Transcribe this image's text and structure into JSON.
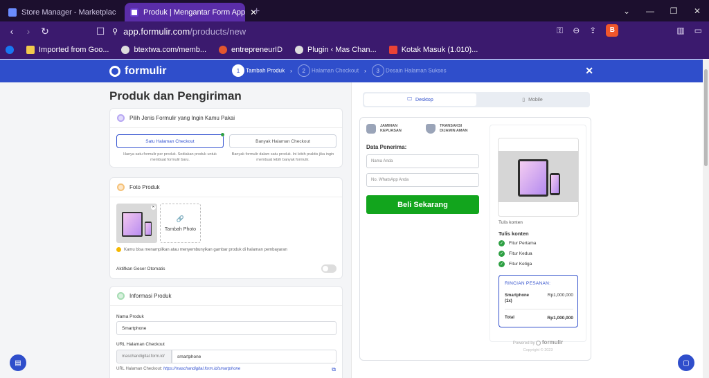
{
  "browser": {
    "tabs": [
      {
        "title": "Store Manager - Marketplace Mas C",
        "active": false
      },
      {
        "title": "Produk | Mengantar Form App",
        "active": true
      }
    ],
    "new_tab": "+",
    "url_host": "app.formulir.com",
    "url_path": "/products/new",
    "bookmarks": [
      "Imported from Goo...",
      "btextwa.com/memb...",
      "entrepreneurID",
      "Plugin ‹ Mas Chan...",
      "Kotak Masuk (1.010)..."
    ]
  },
  "header": {
    "logo": "formulir",
    "steps": [
      {
        "num": "1",
        "label": "Tambah Produk",
        "active": true
      },
      {
        "num": "2",
        "label": "Halaman Checkout",
        "active": false
      },
      {
        "num": "3",
        "label": "Desain Halaman Sukses",
        "active": false
      }
    ],
    "close": "✕"
  },
  "left": {
    "title": "Produk dan Pengiriman",
    "formtype": {
      "heading": "Pilih Jenis Formulir yang Ingin Kamu Pakai",
      "single_label": "Satu Halaman Checkout",
      "single_desc": "Hanya satu formulir per produk. Sediakan produk untuk membuat formulir baru.",
      "multi_label": "Banyak Halaman Checkout",
      "multi_desc": "Banyak formulir dalam satu produk. Ini lebih praktis jika ingin membuat lebih banyak formulir."
    },
    "photo": {
      "heading": "Foto Produk",
      "add_label": "Tambah Photo",
      "note": "Kamu bisa menampilkan atau menyembunyikan gambar produk di halaman pembayaran",
      "autoslide_label": "Aktifkan Geser Otomatis"
    },
    "info": {
      "heading": "Informasi Produk",
      "name_label": "Nama Produk",
      "name_value": "Smartphone",
      "url_label": "URL Halaman Checkout",
      "url_prefix": "maschandigital.form.id/",
      "url_value": "smartphone",
      "url_note_prefix": "URL Halaman Checkout:",
      "url_note_link": "https://maschandigital.form.id/smartphone"
    }
  },
  "right": {
    "view_tabs": {
      "desktop": "Desktop",
      "mobile": "Mobile"
    },
    "badges": [
      {
        "line1": "JAMINAN",
        "line2": "KEPUASAN"
      },
      {
        "line1": "TRANSAKSI",
        "line2": "DIJAMIN AMAN"
      }
    ],
    "receiver_label": "Data Penerima:",
    "name_placeholder": "Nama Anda",
    "wa_placeholder": "No. WhatsApp Anda",
    "buy_button": "Beli Sekarang",
    "product": {
      "content_small": "Tulis konten",
      "content_bold": "Tulis konten",
      "features": [
        "Fitur Pertama",
        "Fitur Kedua",
        "Fitur Ketiga"
      ]
    },
    "order": {
      "title": "RINCIAN PESANAN:",
      "item_name": "Smartphone",
      "item_qty": "(1x)",
      "item_price": "Rp1,000,000",
      "total_label": "Total",
      "total_value": "Rp1,000,000"
    },
    "powered_by": "Powered by",
    "powered_brand": "formulir",
    "copyright": "Copyright © 2023"
  }
}
